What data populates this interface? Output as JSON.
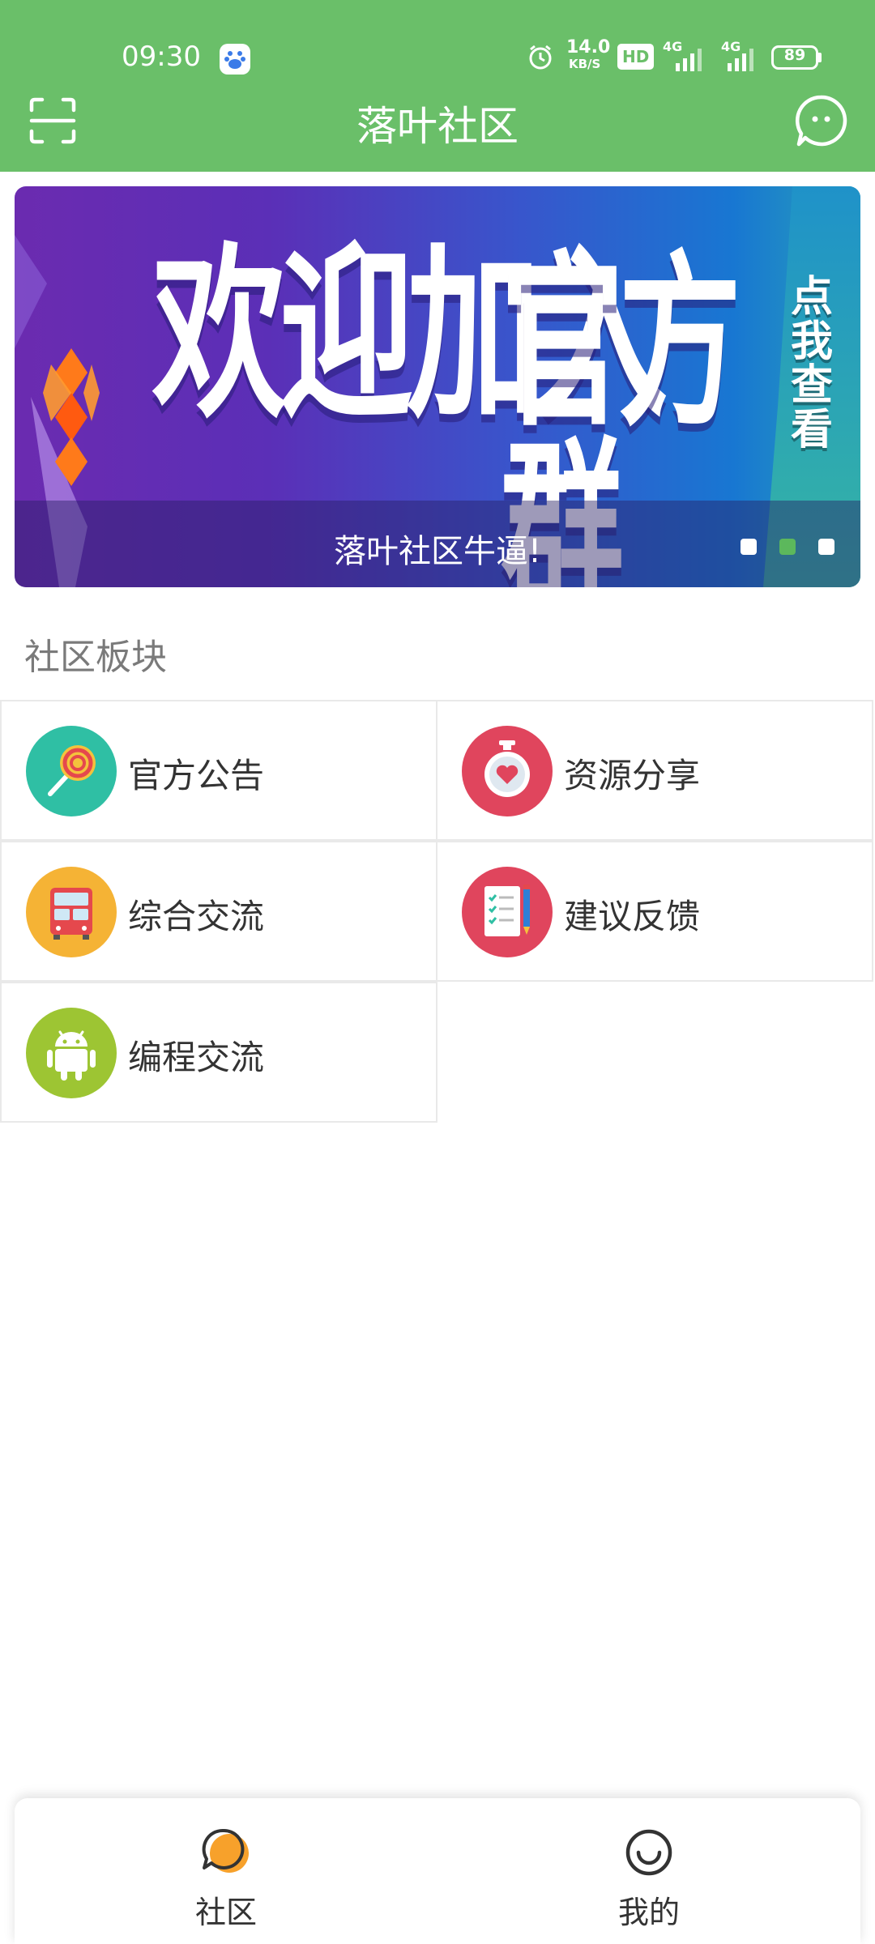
{
  "status_bar": {
    "time": "09:30",
    "speed": "14.0",
    "speed_unit": "KB/S",
    "hd": "HD",
    "net1": "4G",
    "net2": "4G",
    "battery": "89"
  },
  "header": {
    "title": "落叶社区",
    "scan_icon": "scan-icon",
    "message_icon": "message-icon",
    "background": "#6abf69"
  },
  "banner": {
    "headline_1": "欢迎加入",
    "headline_2": "官方群",
    "side_text": "点我查看",
    "caption": "落叶社区牛逼!",
    "active_dot": 2,
    "dot_count": 3
  },
  "section": {
    "title": "社区板块"
  },
  "boards": [
    {
      "label": "官方公告",
      "icon": "lollipop-icon",
      "color": "#2fbfa4"
    },
    {
      "label": "资源分享",
      "icon": "stopwatch-heart-icon",
      "color": "#e0455d"
    },
    {
      "label": "综合交流",
      "icon": "bus-icon",
      "color": "#f5b335"
    },
    {
      "label": "建议反馈",
      "icon": "checklist-icon",
      "color": "#e0455d"
    },
    {
      "label": "编程交流",
      "icon": "android-icon",
      "color": "#9dc533"
    }
  ],
  "bottom_nav": {
    "items": [
      {
        "label": "社区",
        "icon": "chat-bubble-icon",
        "active": true
      },
      {
        "label": "我的",
        "icon": "smiley-icon",
        "active": false
      }
    ]
  }
}
